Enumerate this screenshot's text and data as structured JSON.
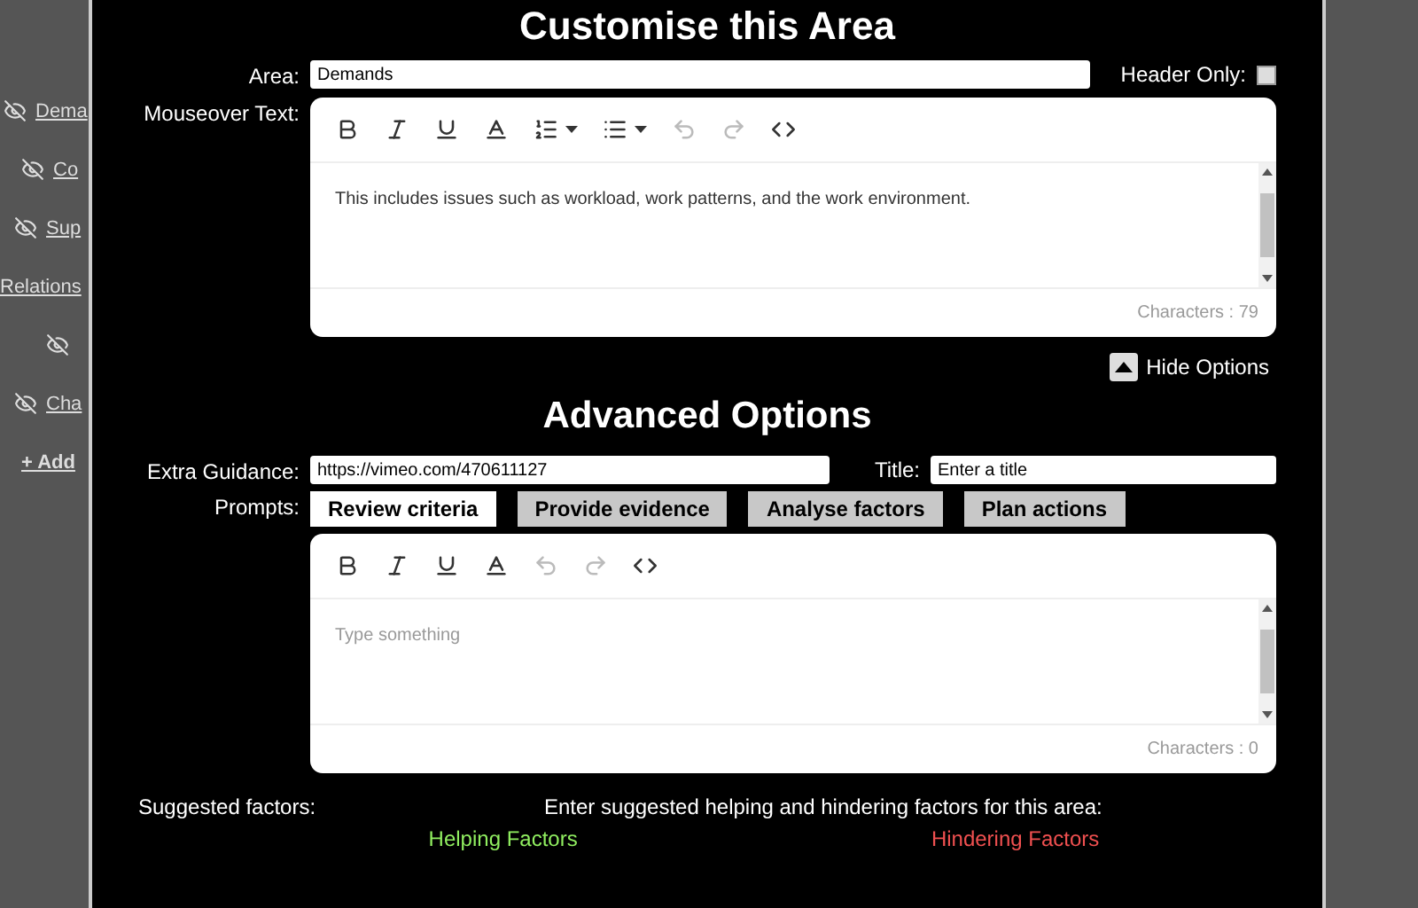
{
  "sidebar": {
    "items": [
      {
        "kind": "item",
        "label": "Dema"
      },
      {
        "kind": "item",
        "label": "Co"
      },
      {
        "kind": "item",
        "label": "Sup"
      },
      {
        "kind": "group",
        "label": "Relations"
      },
      {
        "kind": "icon"
      },
      {
        "kind": "item",
        "label": "Cha"
      },
      {
        "kind": "add",
        "label": "+ Add"
      }
    ]
  },
  "dialog": {
    "title": "Customise this Area",
    "area": {
      "label": "Area:",
      "value": "Demands"
    },
    "header_only": {
      "label": "Header Only:",
      "checked": false
    },
    "mouseover": {
      "label": "Mouseover Text:",
      "text": "This includes issues such as workload, work patterns, and the work environment.",
      "count": "Characters : 79"
    },
    "hide_options": "Hide Options",
    "advanced_title": "Advanced Options",
    "extra_guidance": {
      "label": "Extra Guidance:",
      "value": "https://vimeo.com/470611127"
    },
    "title_field": {
      "label": "Title:",
      "placeholder": "Enter a title"
    },
    "prompts": {
      "label": "Prompts:",
      "tabs": [
        {
          "label": "Review criteria",
          "selected": true
        },
        {
          "label": "Provide evidence",
          "selected": false
        },
        {
          "label": "Analyse factors",
          "selected": false
        },
        {
          "label": "Plan actions",
          "selected": false
        }
      ],
      "placeholder": "Type something",
      "count": "Characters : 0"
    },
    "suggested": {
      "label": "Suggested factors:",
      "text": "Enter suggested helping and hindering factors for this area:"
    },
    "factor_columns": [
      {
        "label": "Helping Factors",
        "color": "#90ee60"
      },
      {
        "label": "Hindering Factors",
        "color": "#f05050"
      }
    ]
  }
}
